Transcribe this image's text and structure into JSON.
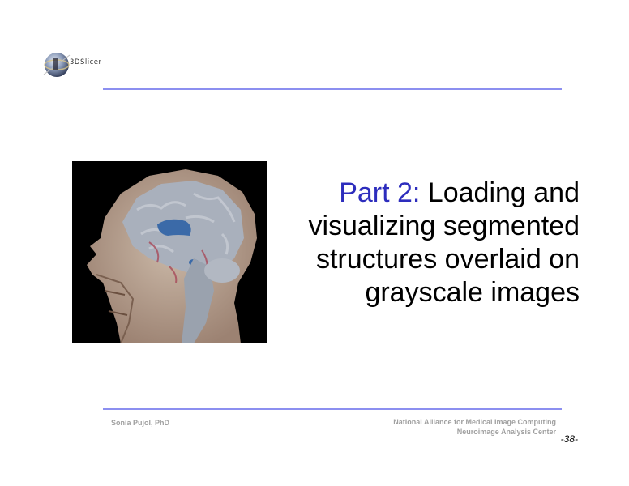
{
  "logo": {
    "text": "3DSlicer",
    "icon": "slicer-globe-icon"
  },
  "title": {
    "part_label": "Part 2:",
    "lines": [
      " Loading and",
      "visualizing segmented",
      "structures overlaid on",
      "grayscale images"
    ]
  },
  "image": {
    "subject": "mri-brain-sagittal"
  },
  "footer": {
    "author": "Sonia Pujol, PhD",
    "org_line1": "National Alliance for Medical Image Computing",
    "org_line2": "Neuroimage Analysis Center",
    "page_number": "-38-"
  },
  "colors": {
    "accent": "#2d2dbd",
    "rule": "#8c8ff0",
    "footer_text": "#a0a0a0"
  }
}
